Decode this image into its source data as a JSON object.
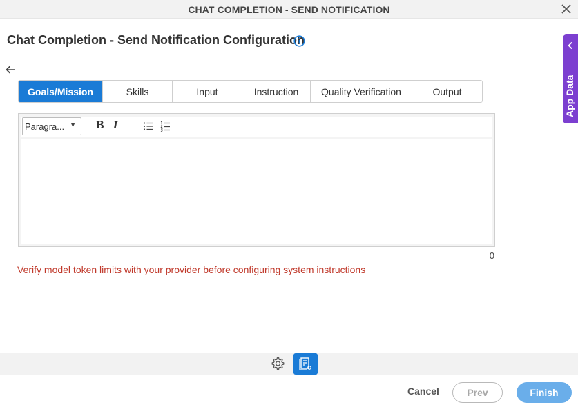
{
  "window": {
    "title": "CHAT COMPLETION - SEND NOTIFICATION"
  },
  "page": {
    "title": "Chat Completion - Send Notification Configuration"
  },
  "tabs": [
    {
      "label": "Goals/Mission",
      "active": true
    },
    {
      "label": "Skills",
      "active": false
    },
    {
      "label": "Input",
      "active": false
    },
    {
      "label": "Instruction",
      "active": false
    },
    {
      "label": "Quality Verification",
      "active": false
    },
    {
      "label": "Output",
      "active": false
    }
  ],
  "editor": {
    "format_value": "Paragra...",
    "bold_label": "B",
    "italic_label": "I",
    "content": "",
    "char_count": "0"
  },
  "warning": "Verify model token limits with your provider before configuring system instructions",
  "side_panel": {
    "label": "App Data"
  },
  "footer": {
    "cancel": "Cancel",
    "prev": "Prev",
    "finish": "Finish"
  },
  "colors": {
    "accent": "#1a7bd6",
    "app_data": "#7c3fd0",
    "warning": "#c0392b",
    "finish": "#6aaeea"
  },
  "icons": [
    "close-icon",
    "info-icon",
    "back-arrow-icon",
    "bullet-list-icon",
    "numbered-list-icon",
    "chevron-left-icon",
    "gear-icon",
    "document-icon"
  ]
}
